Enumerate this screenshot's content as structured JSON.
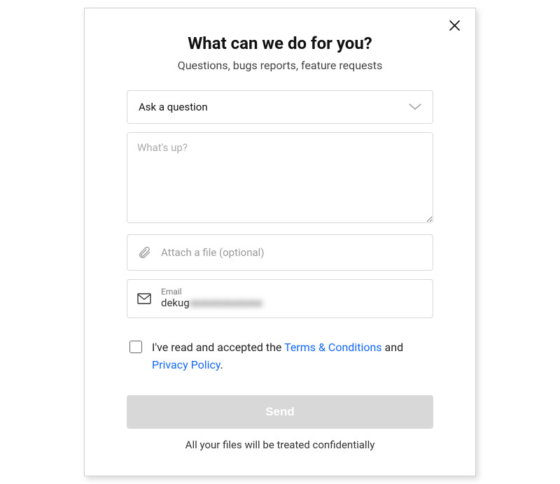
{
  "header": {
    "title": "What can we do for you?",
    "subtitle": "Questions, bugs reports, feature requests"
  },
  "topic_select": {
    "value": "Ask a question"
  },
  "message": {
    "placeholder": "What's up?"
  },
  "attach": {
    "label": "Attach a file (optional)"
  },
  "email": {
    "label": "Email",
    "value_prefix": "dekug",
    "value_obscured": "xxxxxxxxxxxxxx"
  },
  "consent": {
    "prefix": "I've read and accepted the ",
    "terms_link": "Terms & Conditions",
    "middle": " and ",
    "privacy_link": "Privacy Policy",
    "suffix": "."
  },
  "send_button": "Send",
  "footer": "All your files will be treated confidentially"
}
